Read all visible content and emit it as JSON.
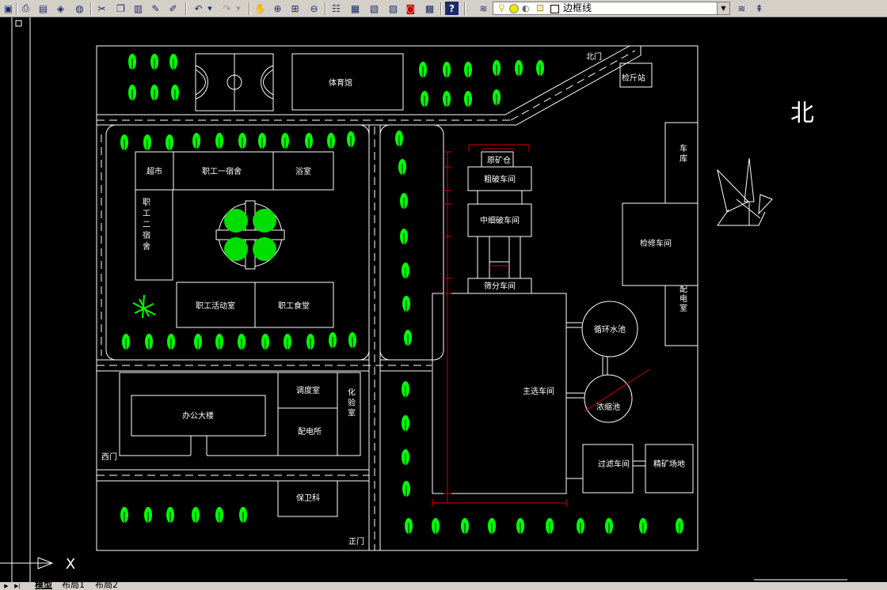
{
  "toolbar": {
    "layer_name": "边框线",
    "buttons": [
      "save",
      "print",
      "plot-preview",
      "publish",
      "3d-dwf",
      "cut",
      "copy",
      "paste",
      "match-properties",
      "block-editor",
      "undo",
      "redo",
      "pan",
      "zoom-realtime",
      "zoom-window",
      "zoom-previous",
      "properties",
      "design-center",
      "tool-palettes",
      "sheet-set",
      "markup",
      "quick-calc",
      "help",
      "layer-manager",
      "layer-states"
    ]
  },
  "drawing": {
    "labels": {
      "north_gate": "北门",
      "inspection_station": "检斤站",
      "gym": "体育馆",
      "supermarket": "超市",
      "dorm1": "职工一宿舍",
      "bath": "浴室",
      "dorm2": "职工二宿舍",
      "activity": "职工活动室",
      "canteen": "职工食堂",
      "dispatch": "调度室",
      "lab": "化验室",
      "office": "办公大楼",
      "power_room": "配电所",
      "west_gate": "西门",
      "security": "保卫科",
      "main_gate": "正门",
      "raw_ore": "原矿仓",
      "coarse": "粗破车间",
      "medium_fine": "中细破车间",
      "screening": "筛分车间",
      "main_plant": "主选车间",
      "circ_pool": "循环水池",
      "thickener": "浓缩池",
      "filter": "过滤车间",
      "concentrate": "精矿场地",
      "garage": "车库",
      "repair": "检修车间",
      "distribution": "配电室",
      "north": "北"
    },
    "ucs": {
      "x_label": "X"
    }
  },
  "tabs": {
    "model": "模型",
    "layout1": "布局1",
    "layout2": "布局2"
  }
}
